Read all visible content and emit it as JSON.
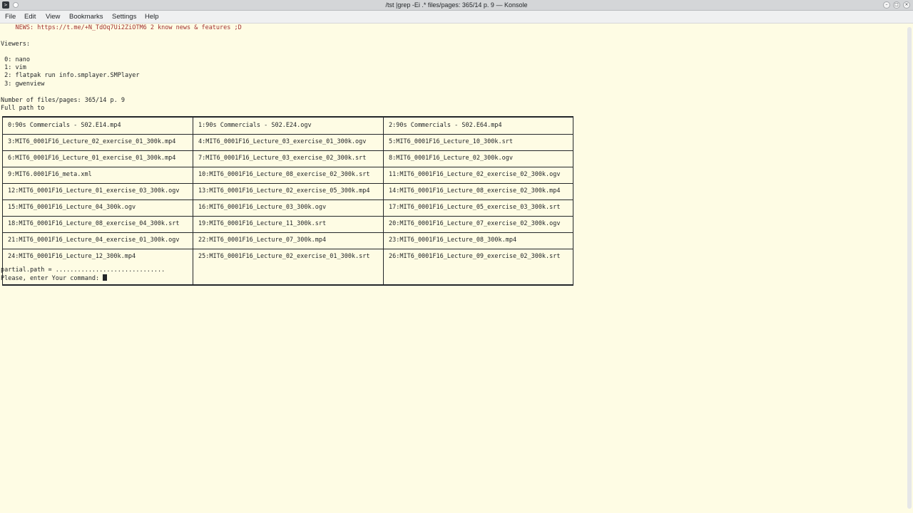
{
  "window": {
    "title": "/tst |grep -Ei .* files/pages: 365/14 p. 9 — Konsole"
  },
  "menu": [
    "File",
    "Edit",
    "View",
    "Bookmarks",
    "Settings",
    "Help"
  ],
  "terminal": {
    "news": "    NEWS: https://t.me/+N_TdOq7Ui2ZiOTM6 2 know news & features ;D",
    "viewers_header": "Viewers:",
    "viewers": [
      " 0: nano",
      " 1: vim",
      " 2: flatpak run info.smplayer.SMPlayer",
      " 3: gwenview"
    ],
    "files_count": "Number of files/pages: 365/14 p. 9",
    "full_path": "Full path to",
    "table": [
      [
        "0:90s Commercials - S02.E14.mp4",
        "1:90s Commercials - S02.E24.ogv",
        "2:90s Commercials - S02.E64.mp4"
      ],
      [
        "3:MIT6_0001F16_Lecture_02_exercise_01_300k.mp4",
        "4:MIT6_0001F16_Lecture_03_exercise_01_300k.ogv",
        "5:MIT6_0001F16_Lecture_10_300k.srt"
      ],
      [
        "6:MIT6_0001F16_Lecture_01_exercise_01_300k.mp4",
        "7:MIT6_0001F16_Lecture_03_exercise_02_300k.srt",
        "8:MIT6_0001F16_Lecture_02_300k.ogv"
      ],
      [
        "9:MIT6.0001F16_meta.xml",
        "10:MIT6_0001F16_Lecture_08_exercise_02_300k.srt",
        "11:MIT6_0001F16_Lecture_02_exercise_02_300k.ogv"
      ],
      [
        "12:MIT6_0001F16_Lecture_01_exercise_03_300k.ogv",
        "13:MIT6_0001F16_Lecture_02_exercise_05_300k.mp4",
        "14:MIT6_0001F16_Lecture_08_exercise_02_300k.mp4"
      ],
      [
        "15:MIT6_0001F16_Lecture_04_300k.ogv",
        "16:MIT6_0001F16_Lecture_03_300k.ogv",
        "17:MIT6_0001F16_Lecture_05_exercise_03_300k.srt"
      ],
      [
        "18:MIT6_0001F16_Lecture_08_exercise_04_300k.srt",
        "19:MIT6_0001F16_Lecture_11_300k.srt",
        "20:MIT6_0001F16_Lecture_07_exercise_02_300k.ogv"
      ],
      [
        "21:MIT6_0001F16_Lecture_04_exercise_01_300k.ogv",
        "22:MIT6_0001F16_Lecture_07_300k.mp4",
        "23:MIT6_0001F16_Lecture_08_300k.mp4"
      ],
      [
        "24:MIT6_0001F16_Lecture_12_300k.mp4",
        "25:MIT6_0001F16_Lecture_02_exercise_01_300k.srt",
        "26:MIT6_0001F16_Lecture_09_exercise_02_300k.srt"
      ]
    ],
    "partial_path": "partial.path = ..............................",
    "prompt": "Please, enter Your command: "
  },
  "colors": {
    "background": "#fefce4",
    "text": "#232629",
    "news": "#a33232"
  }
}
